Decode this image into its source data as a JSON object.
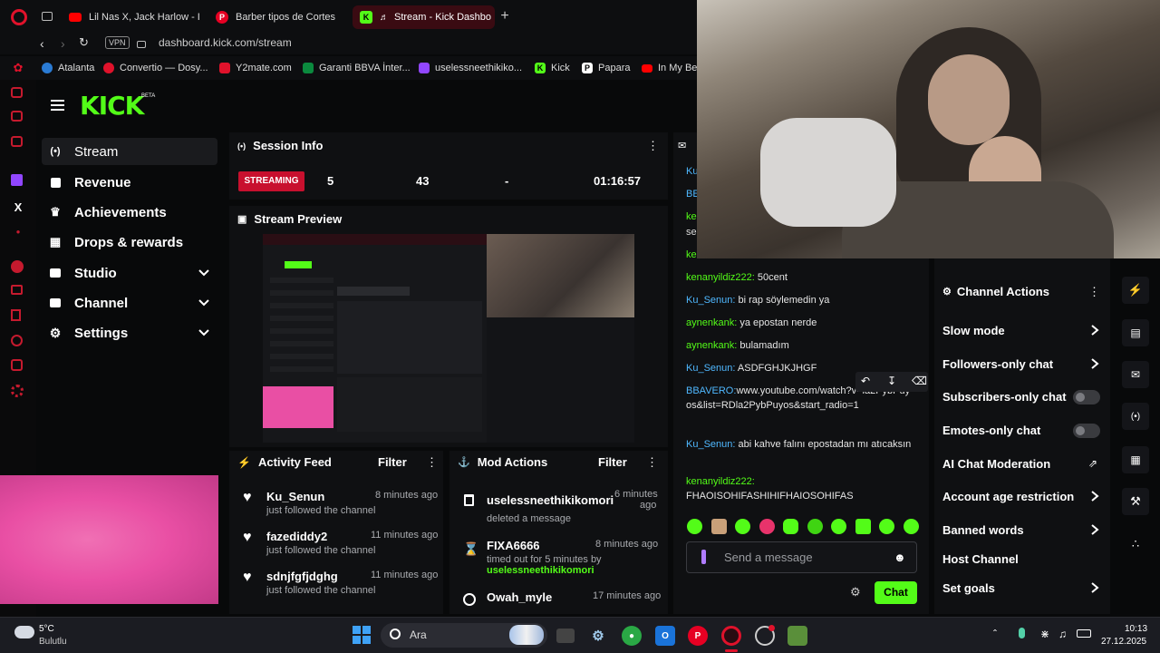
{
  "browser": {
    "tabs": [
      {
        "label": "Lil Nas X, Jack Harlow - II",
        "icon": "youtube-icon"
      },
      {
        "label": "Barber tipos de Cortes",
        "icon": "pinterest-icon"
      },
      {
        "label": "Stream - Kick Dashbo",
        "icon": "kick-icon",
        "active": true
      }
    ],
    "vpn": "VPN",
    "url": "dashboard.kick.com/stream",
    "bookmarks": [
      "Atalanta",
      "Convertio — Dosy...",
      "Y2mate.com",
      "Garanti BBVA İnter...",
      "uselessneethikiko...",
      "Kick",
      "Papara",
      "In My Be"
    ]
  },
  "kick": {
    "logo": "KICK",
    "logo_badge": "BETA",
    "nav": [
      {
        "label": "Stream",
        "icon": "broadcast-icon"
      },
      {
        "label": "Revenue",
        "icon": "wallet-icon"
      },
      {
        "label": "Achievements",
        "icon": "trophy-icon"
      },
      {
        "label": "Drops & rewards",
        "icon": "gift-icon"
      },
      {
        "label": "Studio",
        "icon": "studio-icon"
      },
      {
        "label": "Channel",
        "icon": "channel-icon"
      },
      {
        "label": "Settings",
        "icon": "gear-icon"
      }
    ],
    "session": {
      "title": "Session Info",
      "status": "STREAMING",
      "viewers": "5",
      "followers": "43",
      "other": "-",
      "duration": "01:16:57"
    },
    "preview_title": "Stream Preview",
    "activity": {
      "title": "Activity Feed",
      "filter": "Filter",
      "items": [
        {
          "user": "Ku_Senun",
          "action": "just followed the channel",
          "time": "8 minutes ago"
        },
        {
          "user": "fazediddy2",
          "action": "just followed the channel",
          "time": "11 minutes ago"
        },
        {
          "user": "sdnjfgfjdghg",
          "action": "just followed the channel",
          "time": "11 minutes ago"
        }
      ]
    },
    "mod": {
      "title": "Mod Actions",
      "filter": "Filter",
      "items": [
        {
          "user": "uselessneethikikomori",
          "action": "deleted a message",
          "time1": "6 minutes",
          "time2": "ago"
        },
        {
          "user": "FIXA6666",
          "action": "timed out for 5 minutes by",
          "by": "uselessneethikikomori",
          "time": "8 minutes ago"
        },
        {
          "user": "Owah_myle",
          "time": "17 minutes ago"
        }
      ]
    },
    "chat": {
      "partial": [
        {
          "user": "Ku"
        },
        {
          "user": "BE"
        },
        {
          "user": "ke",
          "text": "se"
        },
        {
          "user": "ke"
        }
      ],
      "messages": [
        {
          "user": "kenanyildiz222:",
          "text": "50cent"
        },
        {
          "user": "Ku_Senun:",
          "text": "bi rap söylemedin ya"
        },
        {
          "user": "aynenkank:",
          "text": "ya epostan nerde"
        },
        {
          "user": "aynenkank:",
          "text": "bulamadım"
        },
        {
          "user": "Ku_Senun:",
          "text": "ASDFGHJKJHGF"
        },
        {
          "user": "BBAVERO:",
          "text": "www.youtube.com/watch?v=la2PybPuyos&list=RDla2PybPuyos&start_radio=1"
        },
        {
          "user": "Ku_Senun:",
          "text": "abi kahve falını epostadan mı atıcaksın"
        },
        {
          "user": "kenanyildiz222:",
          "text": "FHAOISOHIFASHIHIFHAIOSOHIFAS"
        }
      ],
      "placeholder": "Send a message",
      "send": "Chat"
    },
    "channel_actions": {
      "title": "Channel Actions",
      "items": [
        "Slow mode",
        "Followers-only chat",
        "Subscribers-only chat",
        "Emotes-only chat",
        "AI Chat Moderation",
        "Account age restriction",
        "Banned words",
        "Host Channel",
        "Set goals"
      ]
    }
  },
  "taskbar": {
    "weather_temp": "5°C",
    "weather_desc": "Bulutlu",
    "search": "Ara",
    "time": "10:13",
    "date": "27.12.2025"
  },
  "colors": {
    "kick_green": "#53fc18",
    "streaming_red": "#c8102e",
    "accent_pink": "#e8336b"
  }
}
